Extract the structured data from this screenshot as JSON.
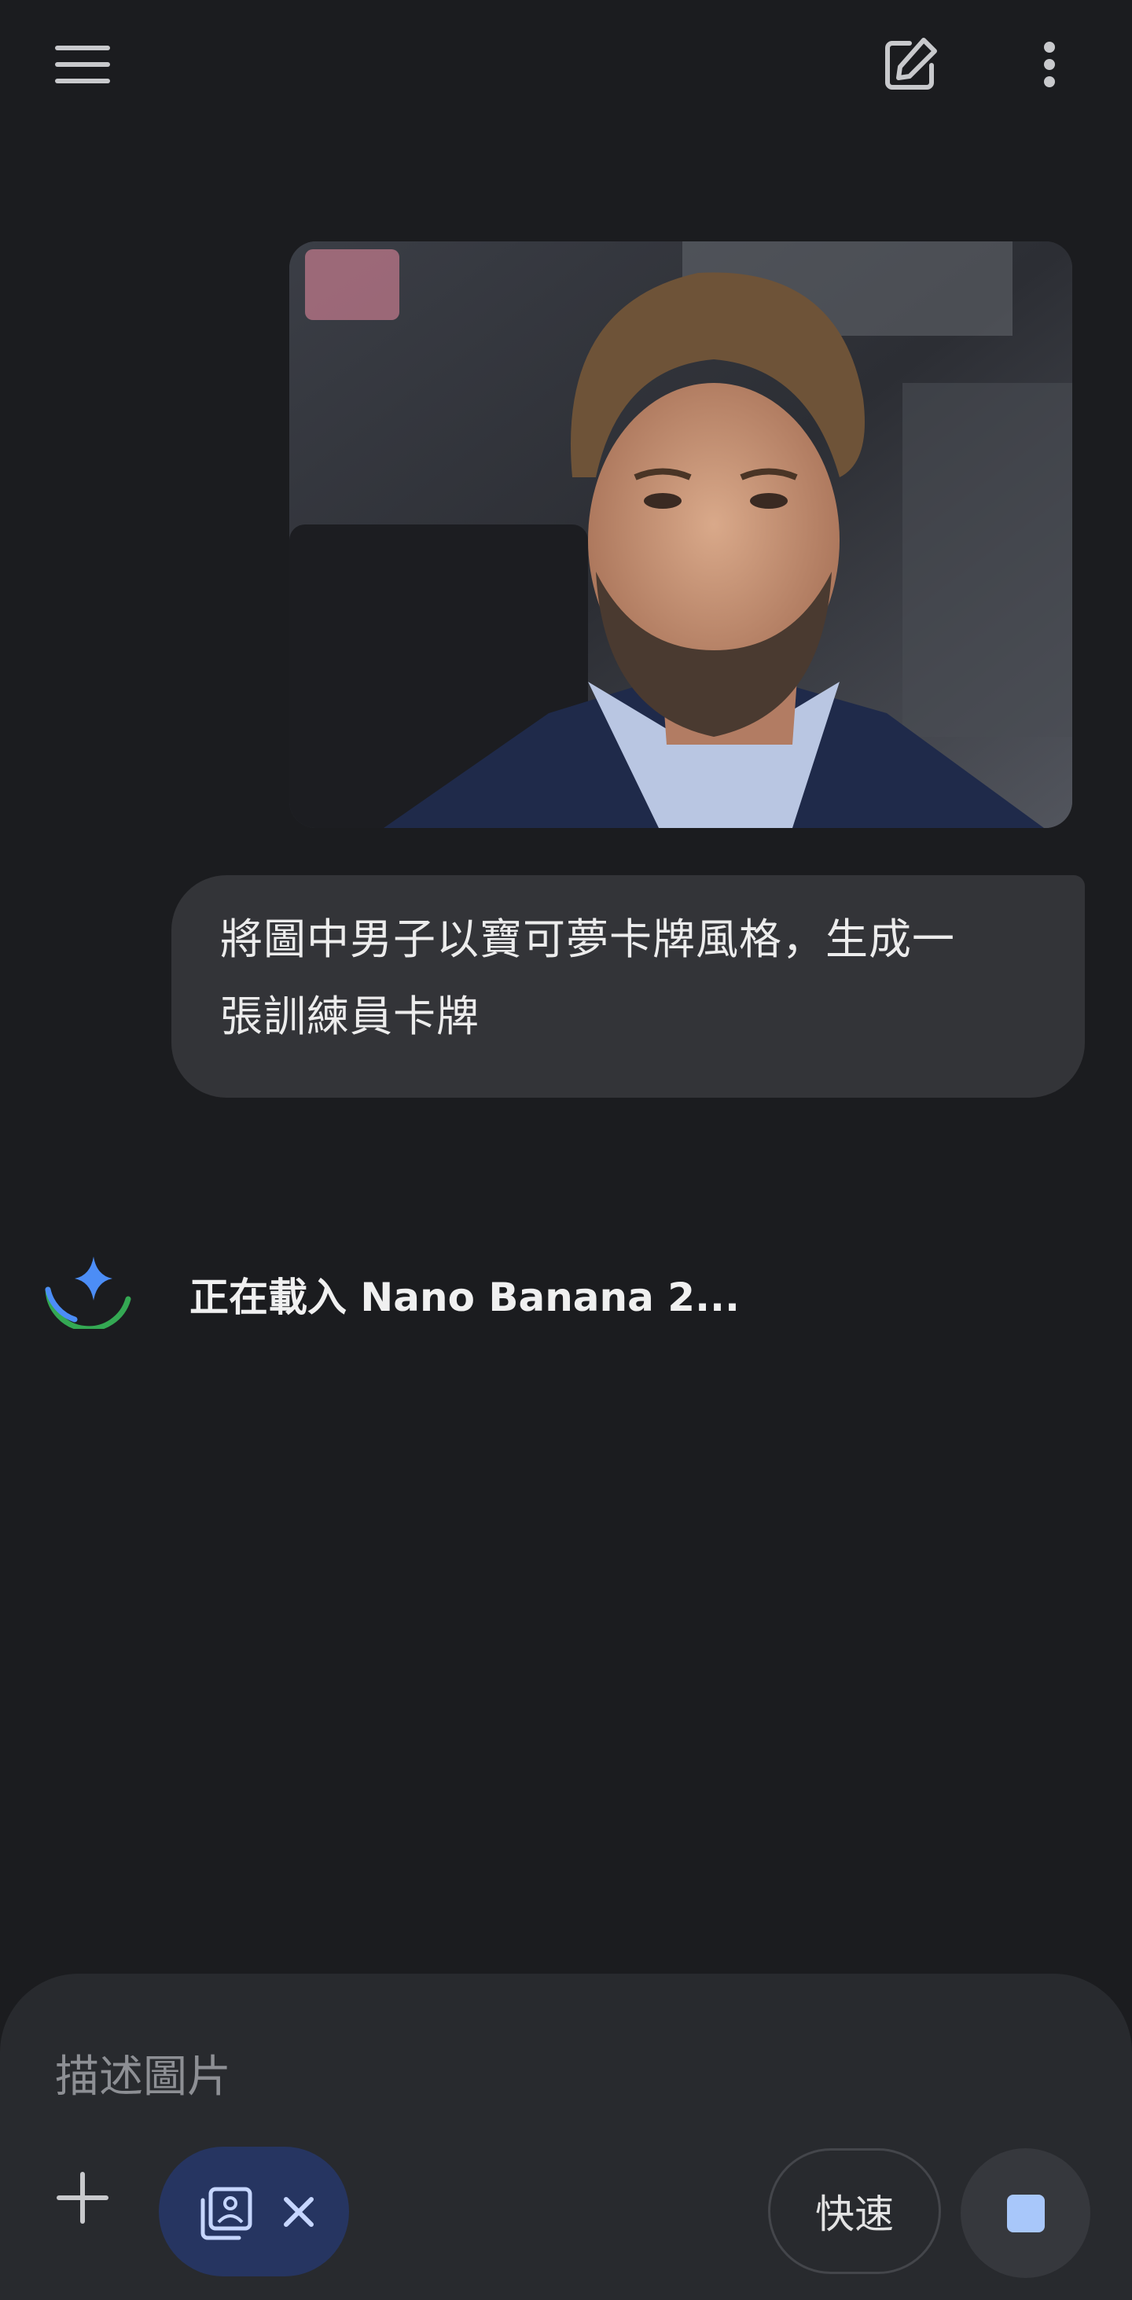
{
  "topbar": {
    "menu_icon": "hamburger-menu-icon",
    "new_chat_icon": "edit-square-icon",
    "more_icon": "more-vertical-icon"
  },
  "conversation": {
    "uploaded_image": {
      "kind": "photo",
      "subject": "man with styled hair and beard wearing navy suit"
    },
    "user_message": {
      "line1": "將圖中男子以寶可夢卡牌風格，生成一",
      "line2": "張訓練員卡牌"
    },
    "assistant": {
      "icon": "gemini-spark-loading-icon",
      "status_text": "正在載入 Nano Banana 2..."
    }
  },
  "composer": {
    "placeholder": "描述圖片",
    "value": "",
    "add_icon": "plus-icon",
    "image_chip_icon": "image-gallery-icon",
    "chip_close_icon": "close-icon",
    "mode_label": "快速",
    "stop_icon": "stop-square-icon"
  },
  "colors": {
    "background": "#1b1c1f",
    "bubble": "#333438",
    "composer": "#282a2e",
    "chip": "#263561",
    "accent": "#a8c7fa",
    "spark_blue": "#4c8df6",
    "spark_green": "#34a853"
  }
}
